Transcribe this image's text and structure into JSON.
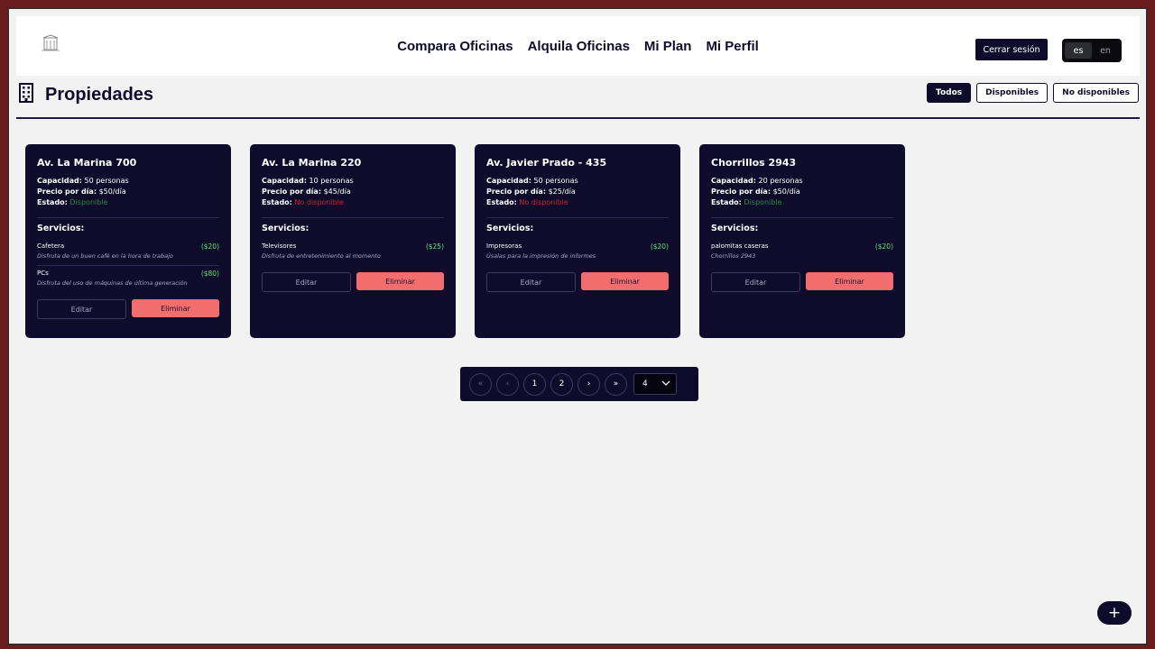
{
  "header": {
    "nav": [
      "Compara Oficinas",
      "Alquila Oficinas",
      "Mi Plan",
      "Mi Perfil"
    ],
    "logout_label": "Cerrar sesión",
    "languages": [
      "es",
      "en"
    ],
    "active_language": "es"
  },
  "page": {
    "title": "Propiedades",
    "filters": [
      "Todos",
      "Disponibles",
      "No disponibles"
    ],
    "active_filter": "Todos"
  },
  "labels": {
    "capacity": "Capacidad:",
    "price": "Precio por día:",
    "status": "Estado:",
    "services": "Servicios:",
    "edit": "Editar",
    "delete": "Eliminar"
  },
  "properties": [
    {
      "title": "Av. La Marina 700",
      "capacity": "50 personas",
      "price": "$50/día",
      "status": "Disponible",
      "services": [
        {
          "name": "Cafetera",
          "price": "($20)",
          "desc": "Disfruta de un buen café en la hora de trabajo"
        },
        {
          "name": "PCs",
          "price": "($80)",
          "desc": "Disfruta del uso de máquinas de última generación"
        }
      ]
    },
    {
      "title": "Av. La Marina 220",
      "capacity": "10 personas",
      "price": "$45/día",
      "status": "No disponible",
      "services": [
        {
          "name": "Televisores",
          "price": "($25)",
          "desc": "Disfruta de entretenimiento al momento"
        }
      ]
    },
    {
      "title": "Av. Javier Prado - 435",
      "capacity": "50 personas",
      "price": "$25/día",
      "status": "No disponible",
      "services": [
        {
          "name": "Impresoras",
          "price": "($20)",
          "desc": "Úsalas para la impresión de informes"
        }
      ]
    },
    {
      "title": "Chorrillos 2943",
      "capacity": "20 personas",
      "price": "$50/día",
      "status": "Disponible",
      "services": [
        {
          "name": "palomitas caseras",
          "price": "($20)",
          "desc": "Chorrillos 2943"
        }
      ]
    }
  ],
  "pagination": {
    "first": "«",
    "prev": "‹",
    "pages": [
      "1",
      "2"
    ],
    "next": "›",
    "last": "»",
    "page_size": "4"
  },
  "fab": {
    "label": "+"
  },
  "colors": {
    "primary": "#0e0c2a",
    "danger": "#f26d6d",
    "available": "#2e8b3e",
    "unavailable": "#d21f2e",
    "price": "#5fe07a"
  },
  "icons": {
    "logo": "building-logo-icon",
    "title": "building-icon",
    "select": "chevron-down-icon",
    "fab": "plus-icon"
  }
}
